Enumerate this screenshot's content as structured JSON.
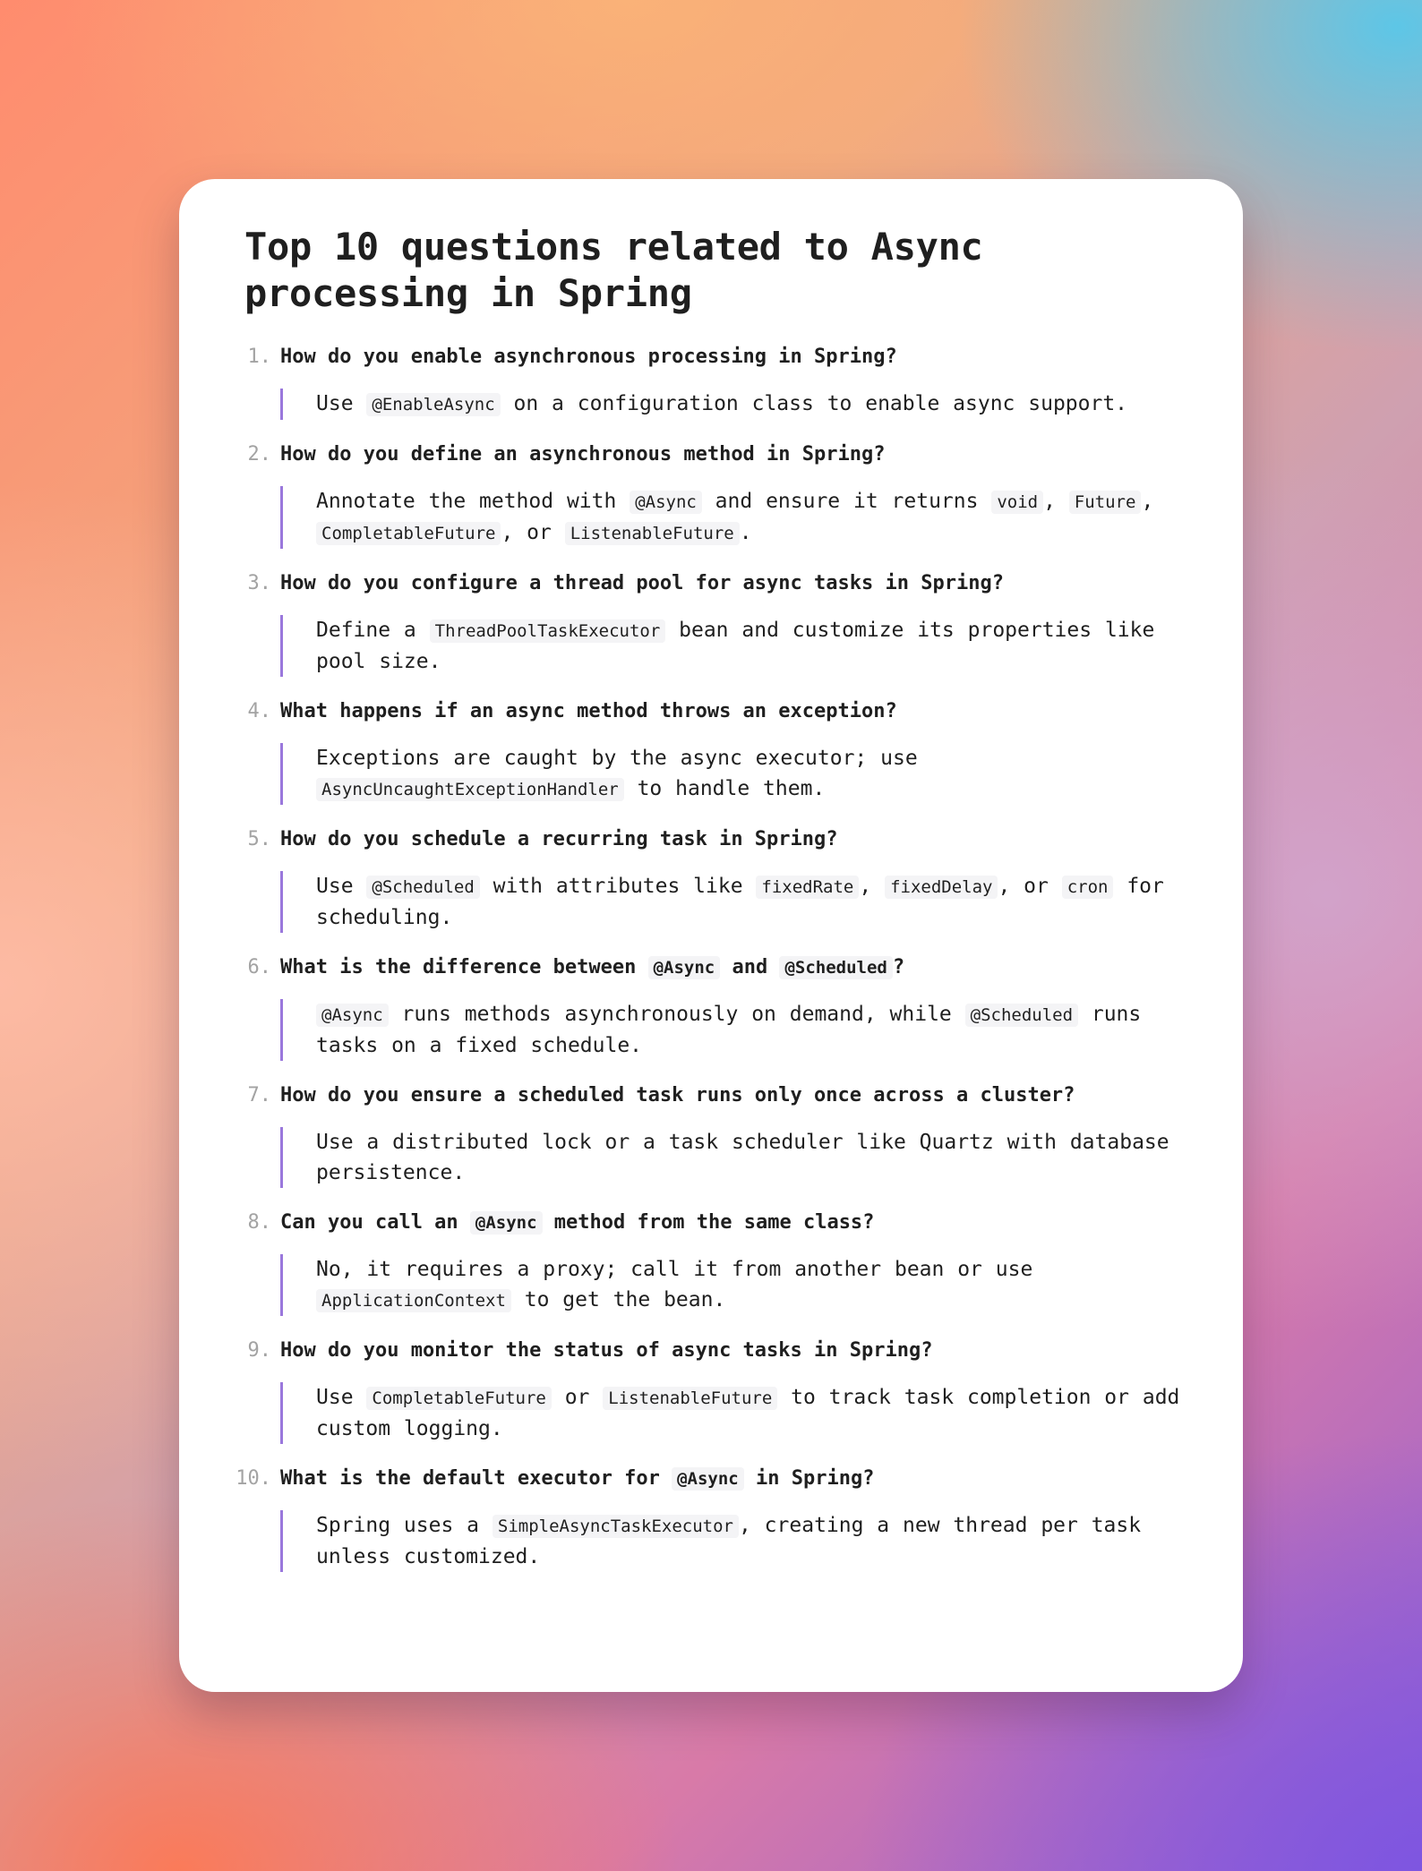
{
  "title": "Top 10 questions related to Async processing in Spring",
  "accent_color": "#9a78dc",
  "items": [
    {
      "number": "1.",
      "question": [
        {
          "t": "How do you enable asynchronous processing in Spring?"
        }
      ],
      "answer": [
        {
          "t": "Use "
        },
        {
          "c": "@EnableAsync"
        },
        {
          "t": " on a configuration class to enable async support."
        }
      ]
    },
    {
      "number": "2.",
      "question": [
        {
          "t": "How do you define an asynchronous method in Spring?"
        }
      ],
      "answer": [
        {
          "t": "Annotate the method with "
        },
        {
          "c": "@Async"
        },
        {
          "t": " and ensure it returns "
        },
        {
          "c": "void"
        },
        {
          "t": ", "
        },
        {
          "c": "Future"
        },
        {
          "t": ", "
        },
        {
          "c": "CompletableFuture"
        },
        {
          "t": ", or "
        },
        {
          "c": "ListenableFuture"
        },
        {
          "t": "."
        }
      ]
    },
    {
      "number": "3.",
      "question": [
        {
          "t": "How do you configure a thread pool for async tasks in Spring?"
        }
      ],
      "answer": [
        {
          "t": "Define a "
        },
        {
          "c": "ThreadPoolTaskExecutor"
        },
        {
          "t": " bean and customize its properties like pool size."
        }
      ]
    },
    {
      "number": "4.",
      "question": [
        {
          "t": "What happens if an async method throws an exception?"
        }
      ],
      "answer": [
        {
          "t": "Exceptions are caught by the async executor; use "
        },
        {
          "c": "AsyncUncaughtExceptionHandler"
        },
        {
          "t": " to handle them."
        }
      ]
    },
    {
      "number": "5.",
      "question": [
        {
          "t": "How do you schedule a recurring task in Spring?"
        }
      ],
      "answer": [
        {
          "t": "Use "
        },
        {
          "c": "@Scheduled"
        },
        {
          "t": " with attributes like "
        },
        {
          "c": "fixedRate"
        },
        {
          "t": ", "
        },
        {
          "c": "fixedDelay"
        },
        {
          "t": ", or "
        },
        {
          "c": "cron"
        },
        {
          "t": " for scheduling."
        }
      ]
    },
    {
      "number": "6.",
      "question": [
        {
          "t": "What is the difference between "
        },
        {
          "c": "@Async"
        },
        {
          "t": " and "
        },
        {
          "c": "@Scheduled"
        },
        {
          "t": "?"
        }
      ],
      "answer": [
        {
          "c": "@Async"
        },
        {
          "t": " runs methods asynchronously on demand, while "
        },
        {
          "c": "@Scheduled"
        },
        {
          "t": " runs tasks on a fixed schedule."
        }
      ]
    },
    {
      "number": "7.",
      "question": [
        {
          "t": "How do you ensure a scheduled task runs only once across a cluster?"
        }
      ],
      "answer": [
        {
          "t": "Use a distributed lock or a task scheduler like Quartz with database persistence."
        }
      ]
    },
    {
      "number": "8.",
      "question": [
        {
          "t": "Can you call an "
        },
        {
          "c": "@Async"
        },
        {
          "t": " method from the same class?"
        }
      ],
      "answer": [
        {
          "t": "No, it requires a proxy; call it from another bean or use "
        },
        {
          "c": "ApplicationContext"
        },
        {
          "t": " to get the bean."
        }
      ]
    },
    {
      "number": "9.",
      "question": [
        {
          "t": "How do you monitor the status of async tasks in Spring?"
        }
      ],
      "answer": [
        {
          "t": "Use "
        },
        {
          "c": "CompletableFuture"
        },
        {
          "t": " or "
        },
        {
          "c": "ListenableFuture"
        },
        {
          "t": " to track task completion or add custom logging."
        }
      ]
    },
    {
      "number": "10.",
      "question": [
        {
          "t": "What is the default executor for "
        },
        {
          "c": "@Async"
        },
        {
          "t": " in Spring?"
        }
      ],
      "answer": [
        {
          "t": "Spring uses a "
        },
        {
          "c": "SimpleAsyncTaskExecutor"
        },
        {
          "t": ", creating a new thread per task unless customized."
        }
      ]
    }
  ]
}
